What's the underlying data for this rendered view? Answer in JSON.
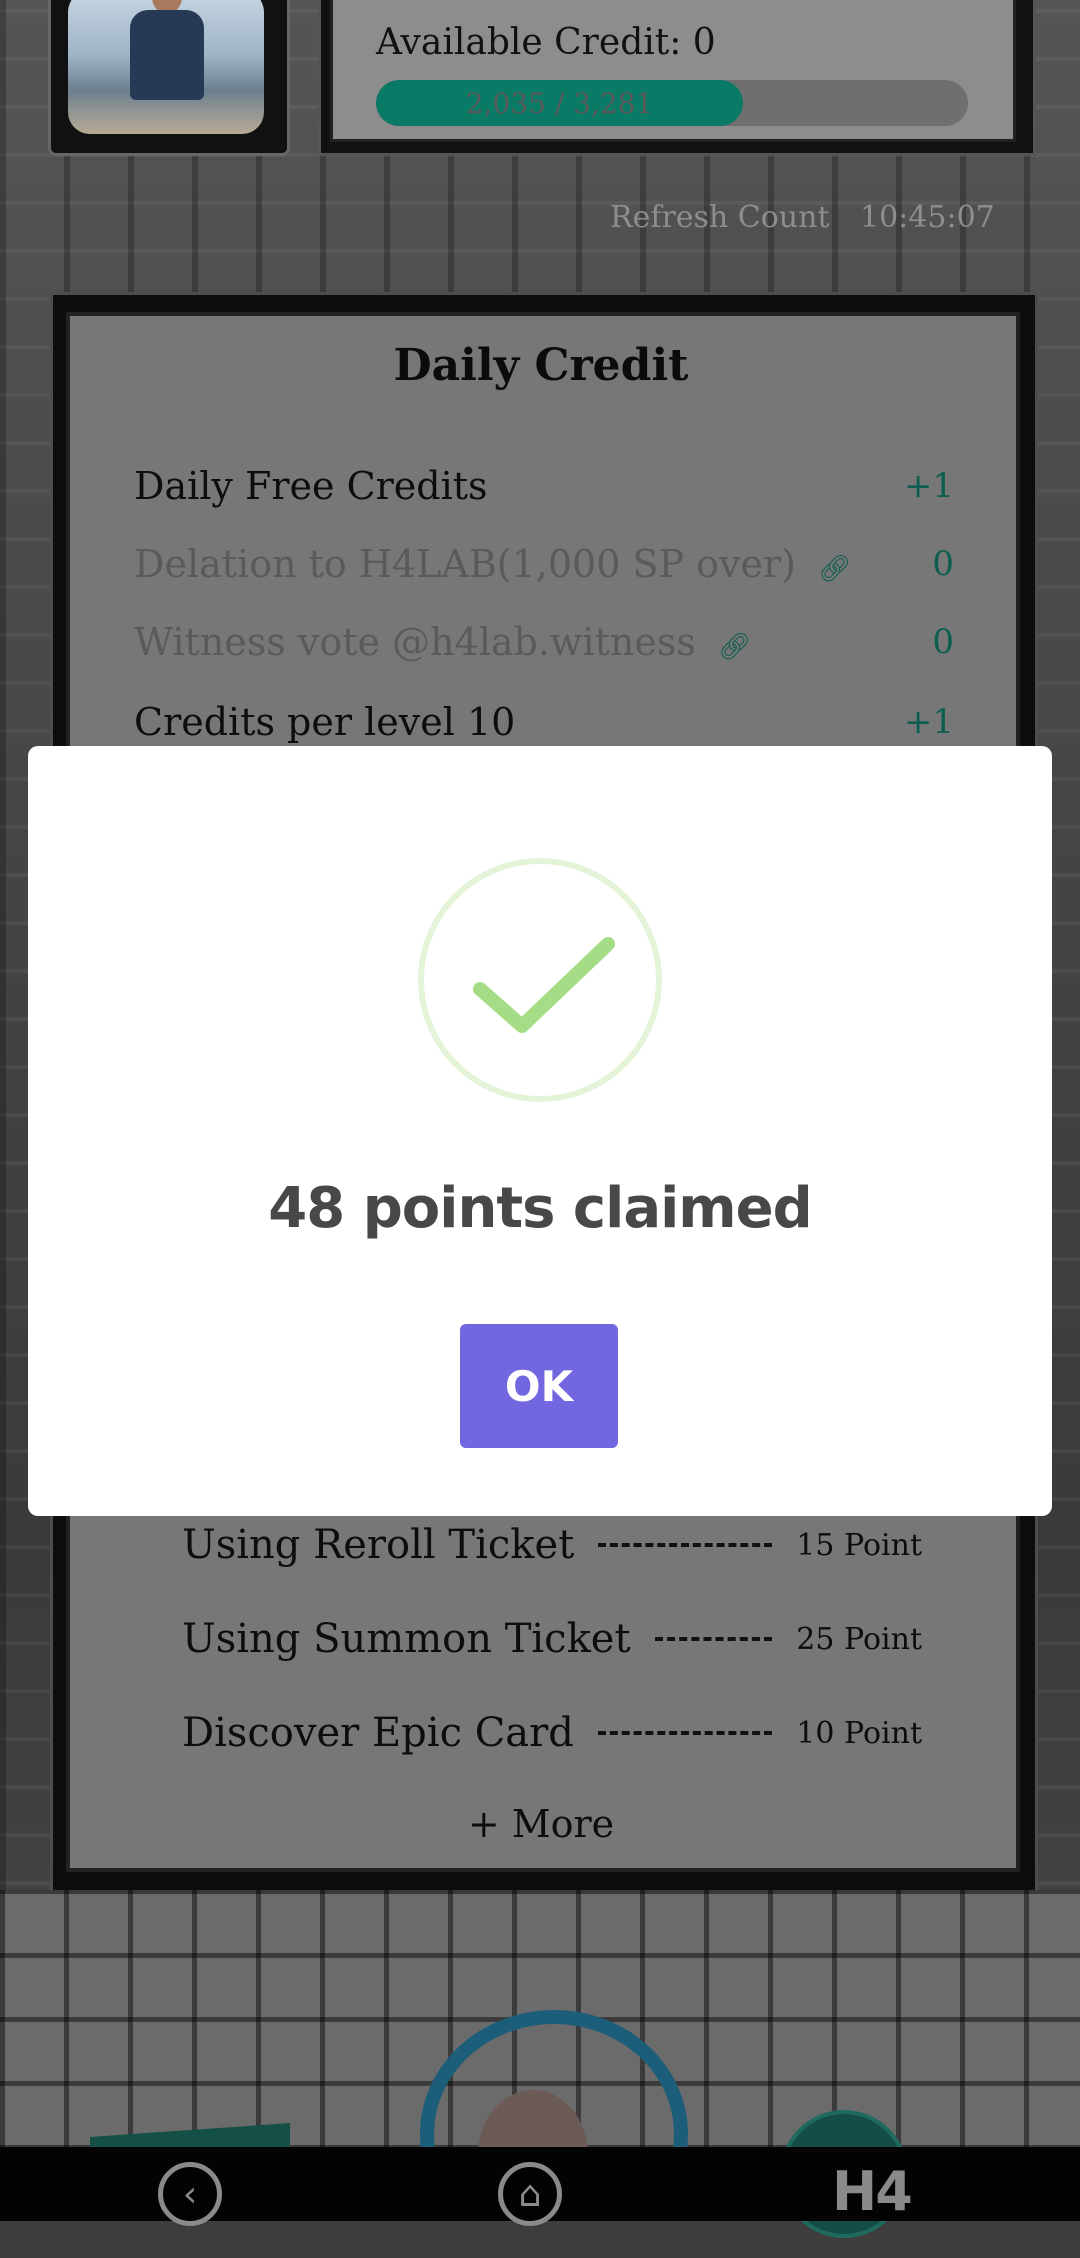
{
  "profile": {
    "available_credit_label": "Available Credit: 0",
    "progress_text": "2,035 / 3,281",
    "progress_fraction": 0.62
  },
  "refresh": {
    "label": "Refresh Count",
    "time": "10:45:07"
  },
  "daily_credit": {
    "title": "Daily Credit",
    "rows": [
      {
        "label": "Daily Free Credits",
        "value": "+1",
        "dim": false
      },
      {
        "label": "Delation to H4LAB(1,000 SP over)",
        "value": "0",
        "dim": true
      },
      {
        "label": "Witness vote @h4lab.witness",
        "value": "0",
        "dim": true
      },
      {
        "label": "Credits per level 10",
        "value": "+1",
        "dim": false
      }
    ],
    "activities": [
      {
        "label": "Using Reroll Ticket",
        "points": "15 Point"
      },
      {
        "label": "Using Summon Ticket",
        "points": "25 Point"
      },
      {
        "label": "Discover Epic Card",
        "points": "10 Point"
      }
    ],
    "more_label": "+ More"
  },
  "dialog": {
    "message": "48 points claimed",
    "ok_label": "OK",
    "check_color": "#a5dc86"
  },
  "nav": {
    "back_icon": "chevron-left-icon",
    "home_icon": "home-icon",
    "logo": "H4"
  }
}
